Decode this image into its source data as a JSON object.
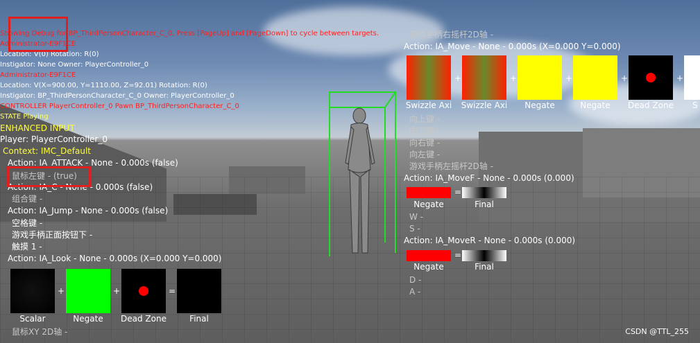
{
  "debug": {
    "header": "Showing Debug for BP_ThirdPersonCharacter_C_0, Press [PageUp] and [PageDown] to cycle between targets.",
    "admin1": "Administrator-E9F1CE",
    "loc1": "Location: V(0) Rotation: R(0)",
    "inst1": "Instigator: None Owner: PlayerController_0",
    "admin2": "Administrator-E9F1CE",
    "loc2": "Location: V(X=900.00, Y=1110.00, Z=92.01) Rotation: R(0)",
    "inst2": "Instigator: BP_ThirdPersonCharacter_C_0 Owner: PlayerController_0",
    "controller": "CONTROLLER PlayerController_0 Pawn BP_ThirdPersonCharacter_C_0",
    "state": "STATE Playing"
  },
  "enhanced": {
    "title": "ENHANCED INPUT",
    "player": "Player: PlayerController_0",
    "context": "Context: IMC_Default",
    "attack": "Action: IA_ATTACK - None - 0.000s (false)",
    "attack_key": "鼠标左键 - (true)",
    "iac": "Action: IA_C - None - 0.000s (false)",
    "iac_key": "组合键 -",
    "jump": "Action: IA_Jump - None - 0.000s (false)",
    "jump_key1": "空格键 -",
    "jump_key2": "游戏手柄正面按钮下 -",
    "jump_key3": "触摸 1 -",
    "look": "Action: IA_Look - None - 0.000s (X=0.000 Y=0.000)",
    "look_axis": "鼠标XY 2D轴 -",
    "look_boxes": [
      {
        "label": "Scalar",
        "color": "#000000"
      },
      {
        "label": "Negate",
        "color": "#00ff00"
      },
      {
        "label": "Dead Zone",
        "color": "#000000"
      },
      {
        "label": "Final",
        "color": "#000000"
      }
    ],
    "op_plus": "+",
    "op_eq": "="
  },
  "right": {
    "axis_header": "游戏手柄右摇杆2D轴 -",
    "move": "Action: IA_Move - None - 0.000s (X=0.000 Y=0.000)",
    "move_boxes": [
      {
        "label": "Swizzle Axi",
        "color": "grad"
      },
      {
        "label": "Swizzle Axi",
        "color": "grad"
      },
      {
        "label": "Negate",
        "color": "#ffff00"
      },
      {
        "label": "Negate",
        "color": "#ffff00"
      },
      {
        "label": "Dead Zone",
        "color": "#000000"
      },
      {
        "label": "S",
        "color": "#ffffff"
      }
    ],
    "keys": [
      "向上键 -",
      "向下键 -",
      "向右键 -",
      "向左键 -"
    ],
    "left_axis": "游戏手柄左摇杆2D轴 -",
    "moveF": "Action: IA_MoveF - None - 0.000s (0.000)",
    "moveF_labels": [
      "Negate",
      "Final"
    ],
    "moveF_keys": [
      "W -",
      "S -"
    ],
    "moveR": "Action: IA_MoveR - None - 0.000s (0.000)",
    "moveR_labels": [
      "Negate",
      "Final"
    ],
    "moveR_keys": [
      "D -",
      "A -"
    ]
  },
  "watermark": "CSDN @TTL_255"
}
